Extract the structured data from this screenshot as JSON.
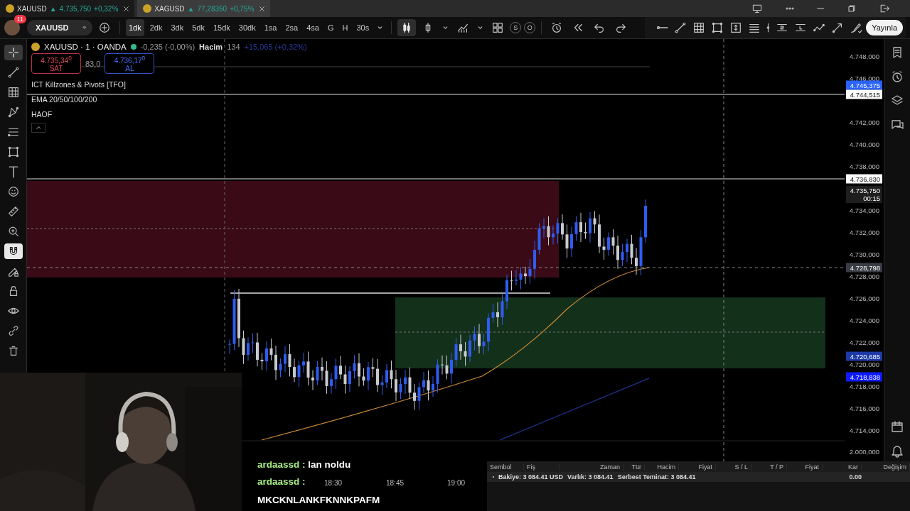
{
  "tabs": [
    {
      "symbol": "XAUUSD",
      "arrow": "▲",
      "price": "4.735,750",
      "change": "+0,32%",
      "selected": true
    },
    {
      "symbol": "XAGUSD",
      "arrow": "▲",
      "price": "77,28350",
      "change": "+0,75%",
      "selected": false
    }
  ],
  "window_controls": [
    {
      "kind": "monitor"
    },
    {
      "kind": "dots"
    },
    {
      "kind": "minimize"
    },
    {
      "kind": "restore"
    },
    {
      "kind": "exit"
    }
  ],
  "toolbar": {
    "notification_count": "11",
    "symbol": "XAUUSD",
    "intervals": [
      {
        "label": "1dk",
        "selected": true
      },
      {
        "label": "2dk",
        "selected": false
      },
      {
        "label": "3dk",
        "selected": false
      },
      {
        "label": "5dk",
        "selected": false
      },
      {
        "label": "15dk",
        "selected": false
      },
      {
        "label": "30dk",
        "selected": false
      },
      {
        "label": "1sa",
        "selected": false
      },
      {
        "label": "2sa",
        "selected": false
      },
      {
        "label": "4sa",
        "selected": false
      },
      {
        "label": "G",
        "selected": false
      },
      {
        "label": "H",
        "selected": false
      },
      {
        "label": "30s",
        "selected": false
      }
    ],
    "tools": [
      {
        "kind": "candles",
        "selected": true
      },
      {
        "kind": "candle",
        "selected": false
      },
      {
        "kind": "caret",
        "selected": false
      },
      {
        "kind": "indicators",
        "selected": false
      },
      {
        "kind": "caret",
        "selected": false
      },
      {
        "kind": "layout",
        "selected": false
      }
    ],
    "session_buttons": [
      "S",
      "O"
    ],
    "history_tools": [
      {
        "kind": "alarm-clock"
      },
      {
        "kind": "rewind"
      },
      {
        "kind": "undo"
      },
      {
        "kind": "redo"
      }
    ],
    "drawing_tools": [
      {
        "kind": "horizontal-ray"
      },
      {
        "kind": "trend-line"
      },
      {
        "kind": "grid"
      },
      {
        "kind": "rectangle"
      },
      {
        "kind": "frame-arrows"
      },
      {
        "kind": "parallel-lines"
      },
      {
        "kind": "vertical-line"
      },
      {
        "kind": "s-lines"
      },
      {
        "kind": "l-lines"
      },
      {
        "kind": "zigzag"
      },
      {
        "kind": "arrow-line"
      },
      {
        "kind": "brush"
      }
    ],
    "publish": "Yayınla"
  },
  "left_tools": [
    {
      "kind": "crosshair",
      "selected": true
    },
    {
      "kind": "trend-line",
      "selected": false
    },
    {
      "kind": "grid",
      "selected": false
    },
    {
      "kind": "nodes",
      "selected": false
    },
    {
      "kind": "lines",
      "selected": false
    },
    {
      "kind": "rectangle",
      "selected": false
    },
    {
      "kind": "text",
      "selected": false
    },
    {
      "kind": "smiley",
      "selected": false
    },
    {
      "kind": "ruler",
      "selected": false
    },
    {
      "kind": "zoom",
      "selected": false
    },
    {
      "kind": "magnet",
      "selected": true
    },
    {
      "kind": "pencil-lock",
      "selected": false
    },
    {
      "kind": "lock",
      "selected": false
    },
    {
      "kind": "eye",
      "selected": false
    },
    {
      "kind": "link",
      "selected": false
    },
    {
      "kind": "trash",
      "selected": false
    }
  ],
  "legend": {
    "title": "XAUUSD · 1 · OANDA",
    "change": "-0,235 (-0,00%)",
    "volume_label": "Hacim",
    "volume": "134",
    "day_change": "+15,065 (+0,32%)",
    "sell": {
      "price": "4.735,34$^{0}$",
      "label": "SAT"
    },
    "spread": "83,0",
    "buy": {
      "price": "4.736,17$^{0}$",
      "label": "AL"
    },
    "indicators": [
      "ICT Killzones & Pivots [TFO]",
      "EMA 20/50/100/200",
      "HAOF"
    ]
  },
  "price_axis": {
    "ticks": [
      "4.748,000",
      "4.746,000",
      "4.742,000",
      "4.740,000",
      "4.738,000",
      "4.734,000",
      "4.732,000",
      "4.730,000",
      "4.728,000",
      "4.726,000",
      "4.724,000",
      "4.722,000",
      "4.720,000",
      "4.718,000",
      "4.716,000",
      "4.714,000",
      "2.000,000"
    ],
    "tags": [
      {
        "price": "4.745,375",
        "color": "#2962ff"
      },
      {
        "price": "4.744,515",
        "color": "#ffffff"
      },
      {
        "price": "4.736,830",
        "color": "#ffffff"
      },
      {
        "price": "4.735,750",
        "sub": "00:15",
        "color": "#1e1e1e"
      },
      {
        "price": "4.728,798",
        "color": "#3a3d45"
      },
      {
        "price": "4.720,685",
        "color": "#1c3aa8"
      },
      {
        "price": "4.718,838",
        "color": "#0d1bff"
      }
    ]
  },
  "time_axis": [
    "18:30",
    "18:45",
    "19:00"
  ],
  "right_tools": [
    {
      "kind": "watchlist"
    },
    {
      "kind": "alarm-clock"
    },
    {
      "kind": "layers"
    },
    {
      "kind": "chat"
    },
    {
      "kind": "calendar"
    },
    {
      "kind": "bell"
    }
  ],
  "chat": {
    "messages": [
      {
        "user": "ardaassd :",
        "text": "lan noldu"
      },
      {
        "user": "ardaassd :"
      }
    ],
    "caption": "MKCKNLANKFKNNKPAFM"
  },
  "trading_panel": {
    "columns": [
      "Sembol",
      "Fiş",
      "Zaman",
      "Tür",
      "Hacim",
      "Fiyat",
      "S / L",
      "T / P",
      "Fiyat",
      "Kar",
      "Değişim"
    ],
    "summary": [
      "Bakiye: 3 084.41 USD",
      "Varlık: 3 084.41",
      "Serbest Teminat: 3 084.41"
    ],
    "profit": "0.00"
  }
}
